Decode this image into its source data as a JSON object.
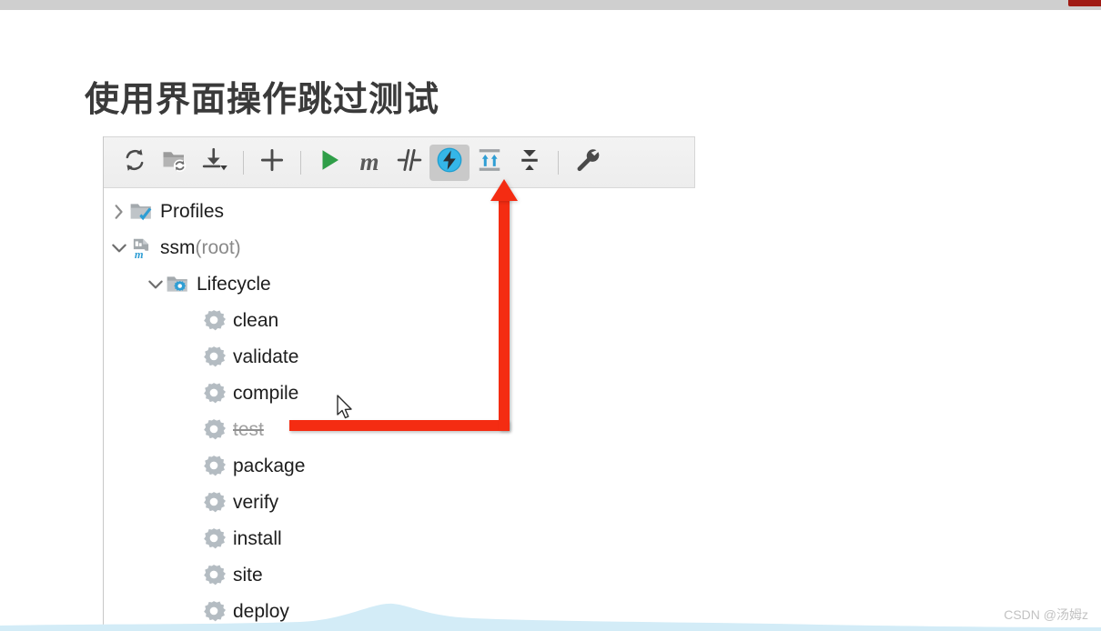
{
  "page": {
    "title": "使用界面操作跳过测试",
    "watermark": "CSDN @汤姆z",
    "background_color": "#d4d4d4",
    "card_color": "#ffffff",
    "accent_red": "#f42c12",
    "top_tab_color": "#a01b14"
  },
  "toolbar": {
    "name": "maven-toolbar",
    "buttons": [
      {
        "icon": "refresh-icon",
        "label": "Reload All Maven Projects",
        "pressed": false
      },
      {
        "icon": "folder-sync-icon",
        "label": "Generate Sources and Update Folders",
        "pressed": false
      },
      {
        "icon": "download-dropdown-icon",
        "label": "Download Sources and Documentation",
        "pressed": false
      },
      {
        "icon": "separator",
        "label": "",
        "pressed": false
      },
      {
        "icon": "plus-icon",
        "label": "Add Maven Project",
        "pressed": false
      },
      {
        "icon": "separator",
        "label": "",
        "pressed": false
      },
      {
        "icon": "play-icon",
        "label": "Run Maven Build",
        "pressed": false
      },
      {
        "icon": "m-italic-icon",
        "label": "Execute Maven Goal",
        "pressed": false
      },
      {
        "icon": "toggle-offline-icon",
        "label": "Toggle Offline Mode",
        "pressed": false
      },
      {
        "icon": "skip-tests-icon",
        "label": "Skip Tests",
        "pressed": true
      },
      {
        "icon": "expand-all-icon",
        "label": "Expand All",
        "pressed": false
      },
      {
        "icon": "collapse-all-icon",
        "label": "Collapse All",
        "pressed": false
      },
      {
        "icon": "separator",
        "label": "",
        "pressed": false
      },
      {
        "icon": "wrench-icon",
        "label": "Maven Settings",
        "pressed": false
      }
    ]
  },
  "tree": {
    "name": "maven-projects-tree",
    "rows": [
      {
        "label": "Profiles",
        "suffix": "",
        "indent": 0,
        "chevron": "right",
        "icon": "folder-check-icon",
        "skipped": false
      },
      {
        "label": "ssm",
        "suffix": " (root)",
        "indent": 0,
        "chevron": "down",
        "icon": "maven-module-icon",
        "skipped": false
      },
      {
        "label": "Lifecycle",
        "suffix": "",
        "indent": 1,
        "chevron": "down",
        "icon": "folder-gear-icon",
        "skipped": false
      },
      {
        "label": "clean",
        "suffix": "",
        "indent": 2,
        "chevron": "none",
        "icon": "gear-icon",
        "skipped": false
      },
      {
        "label": "validate",
        "suffix": "",
        "indent": 2,
        "chevron": "none",
        "icon": "gear-icon",
        "skipped": false
      },
      {
        "label": "compile",
        "suffix": "",
        "indent": 2,
        "chevron": "none",
        "icon": "gear-icon",
        "skipped": false
      },
      {
        "label": "test",
        "suffix": "",
        "indent": 2,
        "chevron": "none",
        "icon": "gear-icon",
        "skipped": true
      },
      {
        "label": "package",
        "suffix": "",
        "indent": 2,
        "chevron": "none",
        "icon": "gear-icon",
        "skipped": false
      },
      {
        "label": "verify",
        "suffix": "",
        "indent": 2,
        "chevron": "none",
        "icon": "gear-icon",
        "skipped": false
      },
      {
        "label": "install",
        "suffix": "",
        "indent": 2,
        "chevron": "none",
        "icon": "gear-icon",
        "skipped": false
      },
      {
        "label": "site",
        "suffix": "",
        "indent": 2,
        "chevron": "none",
        "icon": "gear-icon",
        "skipped": false
      },
      {
        "label": "deploy",
        "suffix": "",
        "indent": 2,
        "chevron": "none",
        "icon": "gear-icon",
        "skipped": false
      }
    ]
  },
  "annotation": {
    "name": "red-arrow",
    "from": "test",
    "to": "skip-tests-icon"
  }
}
